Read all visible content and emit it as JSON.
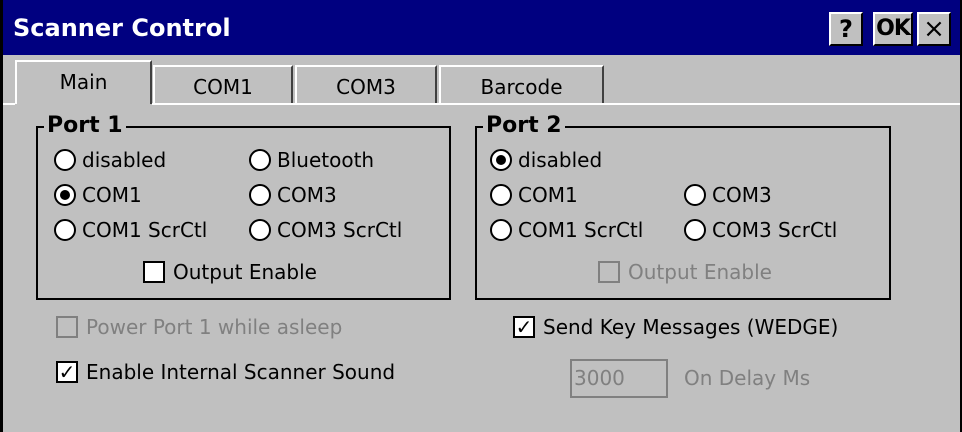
{
  "window": {
    "title": "Scanner Control",
    "help_label": "?",
    "ok_label": "OK",
    "close_label": "×"
  },
  "tabs": [
    {
      "label": "Main",
      "active": true
    },
    {
      "label": "COM1",
      "active": false
    },
    {
      "label": "COM3",
      "active": false
    },
    {
      "label": "Barcode",
      "active": false
    }
  ],
  "port1": {
    "label": "Port 1",
    "options": [
      "disabled",
      "Bluetooth",
      "COM1",
      "COM3",
      "COM1 ScrCtl",
      "COM3 ScrCtl"
    ],
    "selected": "COM1",
    "output_enable": {
      "label": "Output Enable",
      "checked": false,
      "enabled": true
    }
  },
  "port2": {
    "label": "Port 2",
    "options": [
      "disabled",
      "COM1",
      "COM3",
      "COM1 ScrCtl",
      "COM3 ScrCtl"
    ],
    "selected": "disabled",
    "output_enable": {
      "label": "Output Enable",
      "checked": false,
      "enabled": false
    }
  },
  "power_port1": {
    "label": "Power Port 1 while asleep",
    "checked": false,
    "enabled": false
  },
  "internal_sound": {
    "label": "Enable Internal Scanner Sound",
    "checked": true,
    "enabled": true,
    "checkmark": "✓"
  },
  "send_key_messages": {
    "label": "Send Key Messages (WEDGE)",
    "checked": true,
    "enabled": true,
    "checkmark": "✓"
  },
  "on_delay": {
    "label": "On Delay Ms",
    "value": "3000",
    "enabled": false
  }
}
